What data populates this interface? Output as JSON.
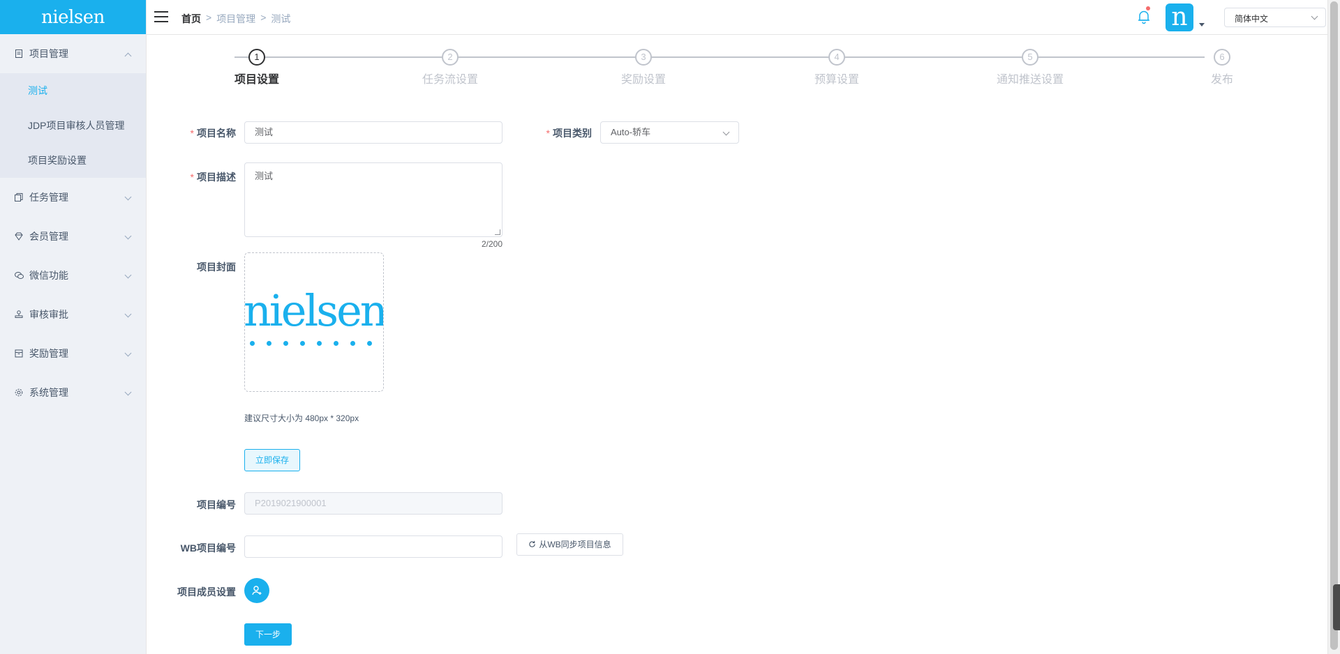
{
  "brand": {
    "logo_text": "nielsen",
    "accent": "#1ab0ed"
  },
  "sidebar": {
    "menus": [
      {
        "label": "项目管理",
        "icon": "document-icon",
        "expanded": true,
        "children": [
          {
            "label": "测试",
            "active": true
          },
          {
            "label": "JDP项目审核人员管理"
          },
          {
            "label": "项目奖励设置"
          }
        ]
      },
      {
        "label": "任务管理",
        "icon": "copy-icon"
      },
      {
        "label": "会员管理",
        "icon": "diamond-icon"
      },
      {
        "label": "微信功能",
        "icon": "chat-icon"
      },
      {
        "label": "审核审批",
        "icon": "stamp-icon"
      },
      {
        "label": "奖励管理",
        "icon": "box-icon"
      },
      {
        "label": "系统管理",
        "icon": "gear-icon"
      }
    ]
  },
  "header": {
    "breadcrumb": {
      "home": "首页",
      "sep": ">",
      "level1": "项目管理",
      "level2": "测试"
    },
    "avatar_letter": "n",
    "language": "简体中文"
  },
  "steps": {
    "current": 1,
    "items": [
      {
        "num": "1",
        "label": "项目设置"
      },
      {
        "num": "2",
        "label": "任务流设置"
      },
      {
        "num": "3",
        "label": "奖励设置"
      },
      {
        "num": "4",
        "label": "预算设置"
      },
      {
        "num": "5",
        "label": "通知推送设置"
      },
      {
        "num": "6",
        "label": "发布"
      }
    ]
  },
  "form": {
    "required_mark": "*",
    "name_label": "项目名称",
    "name_value": "测试",
    "category_label": "项目类别",
    "category_value": "Auto-轿车",
    "desc_label": "项目描述",
    "desc_value": "测试",
    "desc_counter": "2/200",
    "cover_label": "项目封面",
    "cover_image_text": "nielsen",
    "cover_hint": "建议尺寸大小为 480px * 320px",
    "save_button": "立即保存",
    "code_label": "项目编号",
    "code_value": "P2019021900001",
    "wb_label": "WB项目编号",
    "wb_value": "",
    "sync_button": "从WB同步项目信息",
    "members_label": "项目成员设置",
    "next_button": "下一步"
  }
}
